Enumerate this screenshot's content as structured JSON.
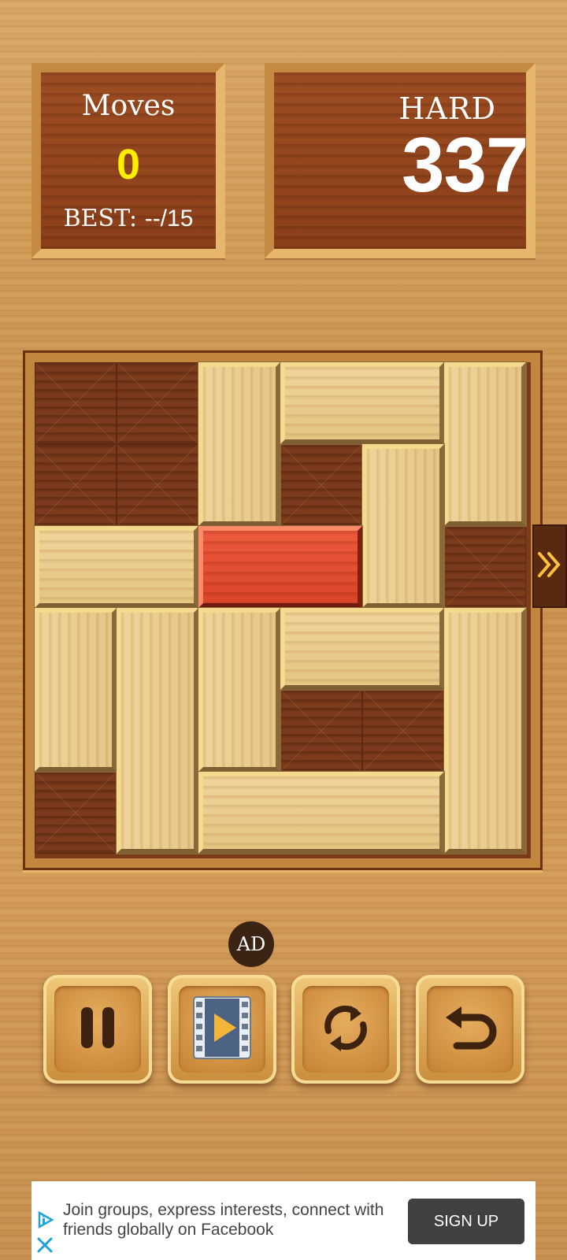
{
  "moves": {
    "title": "Moves",
    "count": "0",
    "best_label": "BEST:",
    "best_value": "--/15"
  },
  "level": {
    "difficulty": "HARD",
    "number": "337"
  },
  "board": {
    "grid": "6x6",
    "exit_row": 3,
    "target_block_color": "#e0502f"
  },
  "ad_badge": "AD",
  "controls": {
    "pause_icon": "pause-icon",
    "video_icon": "video-play-icon",
    "restart_icon": "restart-icon",
    "undo_icon": "undo-icon"
  },
  "ad": {
    "text": "Join groups, express interests, connect with friends globally on Facebook",
    "cta": "SIGN UP"
  }
}
